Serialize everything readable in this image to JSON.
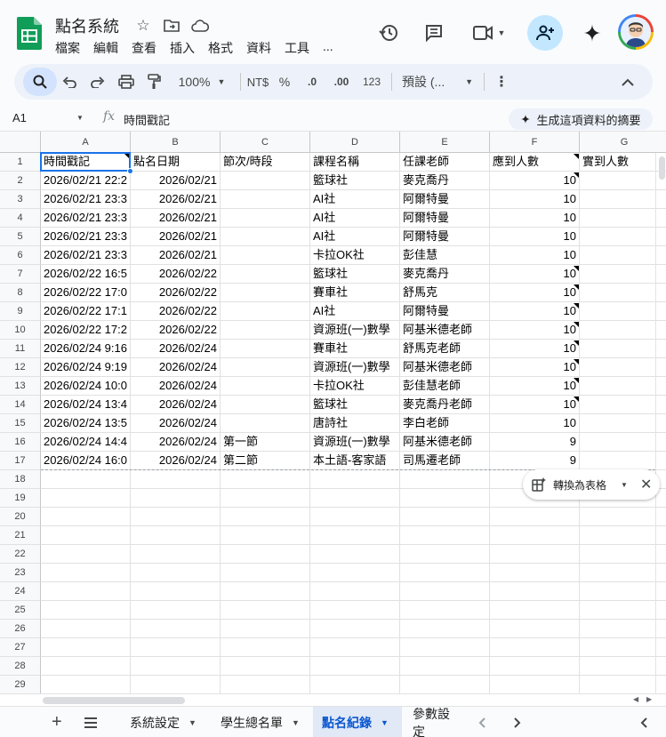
{
  "app": {
    "title": "點名系統",
    "menus": [
      "檔案",
      "編輯",
      "查看",
      "插入",
      "格式",
      "資料",
      "工具",
      "..."
    ]
  },
  "toolbar": {
    "zoom": "100%",
    "currency": "NT$",
    "percent": "%",
    "dec_decrease": ".0",
    "dec_increase": ".00",
    "number_format": "123",
    "font": "預設 (..."
  },
  "formula_bar": {
    "cell_ref": "A1",
    "fx": "fx",
    "value": "時間戳記",
    "summary_label": "生成這項資料的摘要"
  },
  "grid": {
    "columns": [
      "A",
      "B",
      "C",
      "D",
      "E",
      "F",
      "G"
    ],
    "row_numbers": [
      "1",
      "2",
      "3",
      "4",
      "5",
      "6",
      "7",
      "8",
      "9",
      "10",
      "11",
      "12",
      "13",
      "14",
      "15",
      "16",
      "17",
      "18",
      "19",
      "20",
      "21",
      "22",
      "23",
      "24",
      "25",
      "26",
      "27",
      "28",
      "29"
    ],
    "header_row": [
      "時間戳記",
      "點名日期",
      "節次/時段",
      "課程名稱",
      "任課老師",
      "應到人數",
      "實到人數"
    ],
    "rows": [
      [
        "2026/02/21 22:2",
        "2026/02/21",
        "",
        "籃球社",
        "麥克喬丹",
        "10"
      ],
      [
        "2026/02/21 23:3",
        "2026/02/21",
        "",
        "AI社",
        "阿爾特曼",
        "10"
      ],
      [
        "2026/02/21 23:3",
        "2026/02/21",
        "",
        "AI社",
        "阿爾特曼",
        "10"
      ],
      [
        "2026/02/21 23:3",
        "2026/02/21",
        "",
        "AI社",
        "阿爾特曼",
        "10"
      ],
      [
        "2026/02/21 23:3",
        "2026/02/21",
        "",
        "卡拉OK社",
        "彭佳慧",
        "10"
      ],
      [
        "2026/02/22 16:5",
        "2026/02/22",
        "",
        "籃球社",
        "麥克喬丹",
        "10"
      ],
      [
        "2026/02/22 17:0",
        "2026/02/22",
        "",
        "賽車社",
        "舒馬克",
        "10"
      ],
      [
        "2026/02/22 17:1",
        "2026/02/22",
        "",
        "AI社",
        "阿爾特曼",
        "10"
      ],
      [
        "2026/02/22 17:2",
        "2026/02/22",
        "",
        "資源班(一)數學",
        "阿基米德老師",
        "10"
      ],
      [
        "2026/02/24 9:16",
        "2026/02/24",
        "",
        "賽車社",
        "舒馬克老師",
        "10"
      ],
      [
        "2026/02/24 9:19",
        "2026/02/24",
        "",
        "資源班(一)數學",
        "阿基米德老師",
        "10"
      ],
      [
        "2026/02/24 10:0",
        "2026/02/24",
        "",
        "卡拉OK社",
        "彭佳慧老師",
        "10"
      ],
      [
        "2026/02/24 13:4",
        "2026/02/24",
        "",
        "籃球社",
        "麥克喬丹老師",
        "10"
      ],
      [
        "2026/02/24 13:5",
        "2026/02/24",
        "",
        "唐詩社",
        "李白老師",
        "10"
      ],
      [
        "2026/02/24 14:4",
        "2026/02/24",
        "第一節",
        "資源班(一)數學",
        "阿基米德老師",
        "9"
      ],
      [
        "2026/02/24 16:0",
        "2026/02/24",
        "第二節",
        "本土語-客家語",
        "司馬遷老師",
        "9"
      ]
    ]
  },
  "convert_chip": {
    "label": "轉換為表格"
  },
  "sheets": {
    "tabs": [
      "系統設定",
      "學生總名單",
      "點名紀錄",
      "參數設定"
    ],
    "active": "點名紀錄"
  },
  "colors": {
    "accent": "#1a73e8",
    "share_bg": "#c2e7ff",
    "active_tab": "#0b57d0",
    "logo_green": "#0f9d58"
  }
}
